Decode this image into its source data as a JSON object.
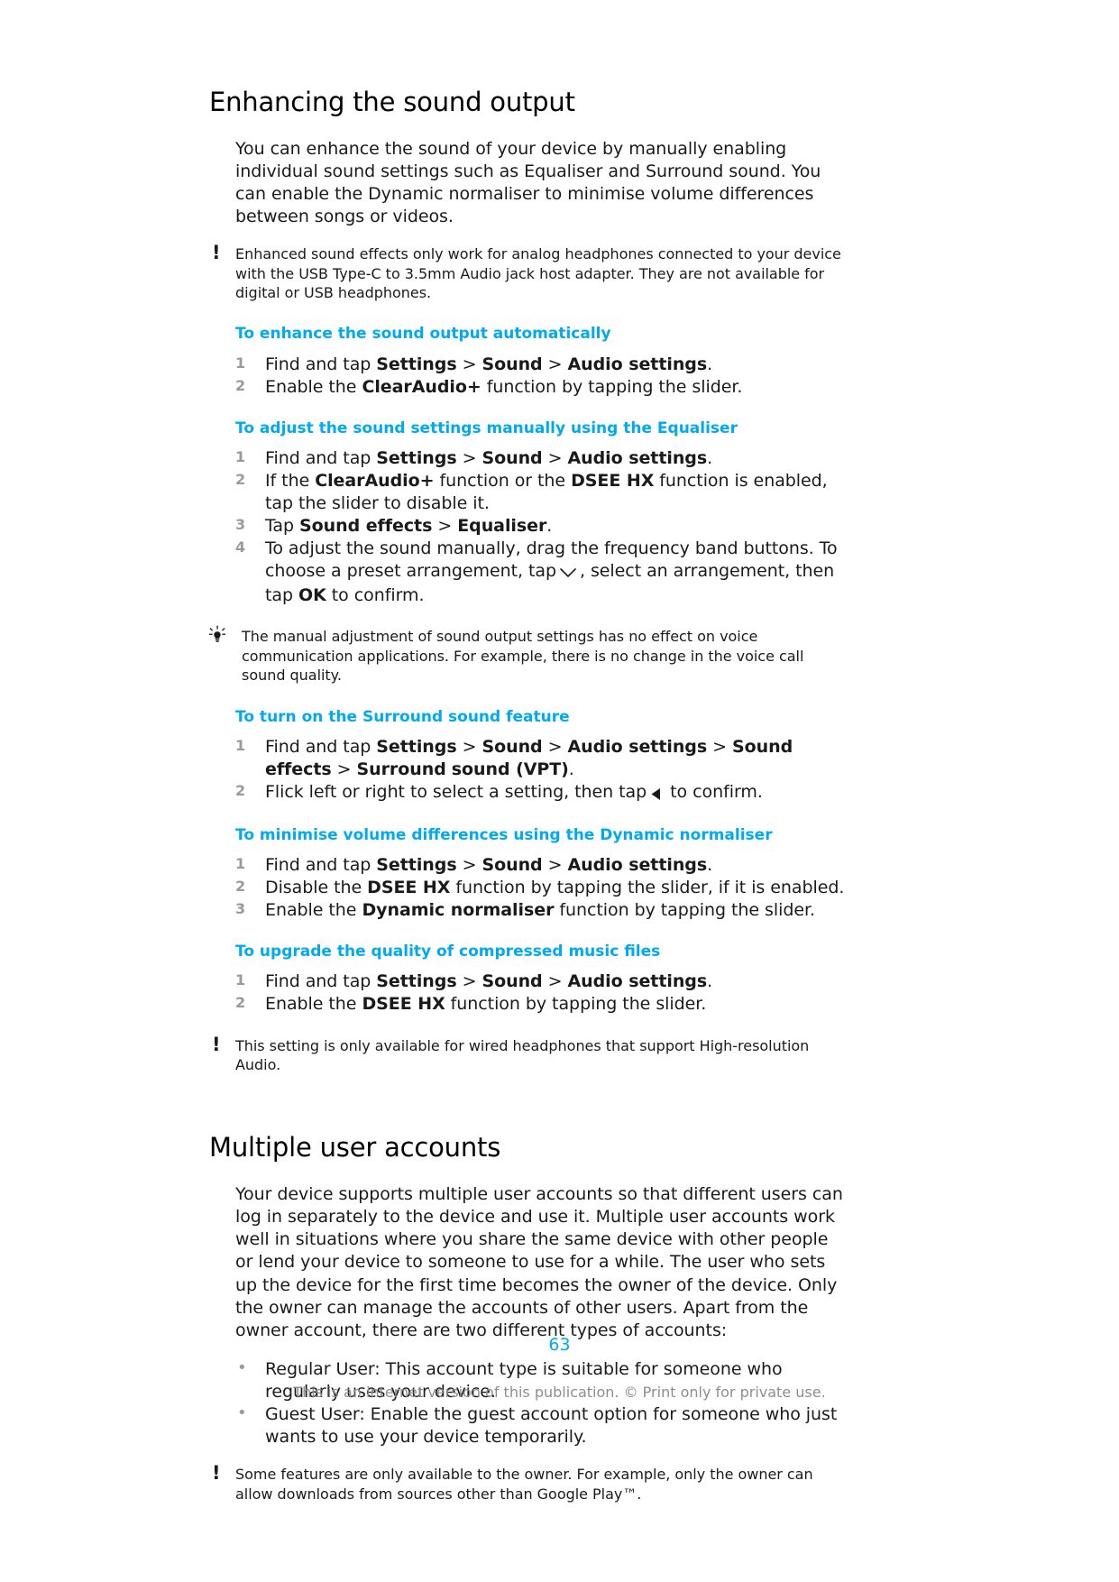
{
  "document": {
    "page_number": "63",
    "footer_note": "This is an internet version of this publication. © Print only for private use.",
    "accent_color": "#00aaf0",
    "number_color": "#9a9a9a"
  },
  "sections": [
    {
      "title": "Enhancing the sound output",
      "intro": "You can enhance the sound of your device by manually enabling individual sound settings such as Equaliser and Surround sound. You can enable the Dynamic normaliser to minimise volume differences between songs or videos.",
      "note_1": {
        "icon": "exclamation-note-icon",
        "text": "Enhanced sound effects only work for analog headphones connected to your device with the USB Type-C to 3.5mm Audio jack host adapter. They are not available for digital or USB headphones."
      },
      "subsections": [
        {
          "heading": "To enhance the sound output automatically",
          "steps": [
            "Find and tap Settings > Sound > Audio settings.",
            "Enable the ClearAudio+ function by tapping the slider."
          ]
        },
        {
          "heading": "To adjust the sound settings manually using the Equaliser",
          "steps": [
            "Find and tap Settings > Sound > Audio settings.",
            "If the ClearAudio+ function or the DSEE HX function is enabled, tap the slider to disable it.",
            "Tap Sound effects > Equaliser.",
            "To adjust the sound manually, drag the frequency band buttons. To choose a preset arrangement, tap ⌄ , select an arrangement, then tap OK to confirm."
          ],
          "tip": {
            "icon": "lightbulb-tip-icon",
            "text": "The manual adjustment of sound output settings has no effect on voice communication applications. For example, there is no change in the voice call sound quality."
          }
        },
        {
          "heading": "To turn on the Surround sound feature",
          "steps": [
            "Find and tap Settings > Sound > Audio settings > Sound effects > Surround sound (VPT).",
            "Flick left or right to select a setting, then tap ◀ to confirm."
          ]
        },
        {
          "heading": "To minimise volume differences using the Dynamic normaliser",
          "steps": [
            "Find and tap Settings > Sound > Audio settings.",
            "Disable the DSEE HX function by tapping the slider, if it is enabled.",
            "Enable the Dynamic normaliser function by tapping the slider."
          ]
        },
        {
          "heading": "To upgrade the quality of compressed music files",
          "steps": [
            "Find and tap Settings > Sound > Audio settings.",
            "Enable the DSEE HX function by tapping the slider."
          ],
          "note": {
            "icon": "exclamation-note-icon",
            "text": "This setting is only available for wired headphones that support High-resolution Audio."
          }
        }
      ]
    },
    {
      "title": "Multiple user accounts",
      "intro": "Your device supports multiple user accounts so that different users can log in separately to the device and use it. Multiple user accounts work well in situations where you share the same device with other people or lend your device to someone to use for a while. The user who sets up the device for the first time becomes the owner of the device. Only the owner can manage the accounts of other users. Apart from the owner account, there are two different types of accounts:",
      "bullets": [
        "Regular User: This account type is suitable for someone who regularly uses your device.",
        "Guest User: Enable the guest account option for someone who just wants to use your device temporarily."
      ],
      "note": {
        "icon": "exclamation-note-icon",
        "text": "Some features are only available to the owner. For example, only the owner can allow downloads from sources other than Google Play™."
      }
    }
  ],
  "inline": {
    "settings": "Settings",
    "sound": "Sound",
    "audio_settings": "Audio settings",
    "clearaudio": "ClearAudio+",
    "dsee_hx": "DSEE HX",
    "sound_effects": "Sound effects",
    "equaliser": "Equaliser",
    "surround_sound_vpt_1": "Surround",
    "surround_sound_vpt_2": "sound (VPT)",
    "dynamic_normaliser": "Dynamic normaliser",
    "ok": "OK",
    "gt": ">",
    "step1_prefix": "Find and tap ",
    "step1_period": ".",
    "ca_prefix": "Enable the ",
    "ca_suffix": " function by tapping the slider.",
    "eq2_prefix": "If the ",
    "eq2_mid": " function or the ",
    "eq2_suffix": " function is enabled, tap the slider to disable it.",
    "eq3_prefix": "Tap ",
    "eq4_a": "To adjust the sound manually, drag the frequency band buttons. To choose a preset arrangement, tap",
    "eq4_b": ", select an arrangement, then tap ",
    "eq4_c": " to confirm.",
    "surround_2a": "Flick left or right to select a setting, then tap",
    "surround_2b": " to confirm.",
    "dn2_prefix": "Disable the ",
    "dn2_suffix": " function by tapping the slider, if it is enabled.",
    "dn3_prefix": "Enable the ",
    "dn3_suffix": " function by tapping the slider.",
    "dsee_prefix": "Enable the ",
    "dsee_suffix": " function by tapping the slider."
  }
}
